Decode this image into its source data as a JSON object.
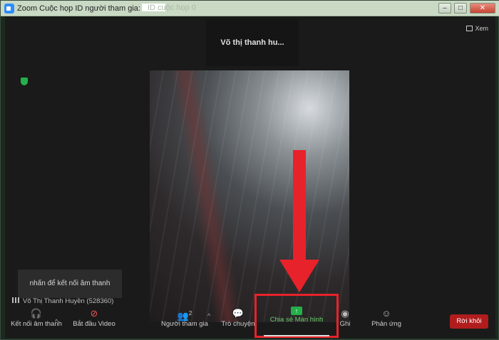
{
  "window": {
    "title": "Zoom Cuộc họp ID người tham gia:",
    "title_faded": "ID cuộc họp 0"
  },
  "meeting": {
    "speaker_name": "Võ thị thanh hu...",
    "view_label": "Xem",
    "audio_hint": "nhấn để kết nối âm thanh",
    "participant_label": "Võ Thị Thanh Huyền (528360)"
  },
  "toolbar": {
    "connect_audio": "Kết nối âm thanh",
    "start_video": "Bắt đầu Video",
    "participants": "Người tham gia",
    "participants_count": "2",
    "chat": "Trò chuyện",
    "share_screen": "Chia sẻ Màn hình",
    "record": "Ghi",
    "reactions": "Phản ứng",
    "leave": "Rời khỏi"
  },
  "colors": {
    "highlight_red": "#e8222a",
    "share_green": "#23b04b",
    "leave_red": "#b11d1d"
  }
}
